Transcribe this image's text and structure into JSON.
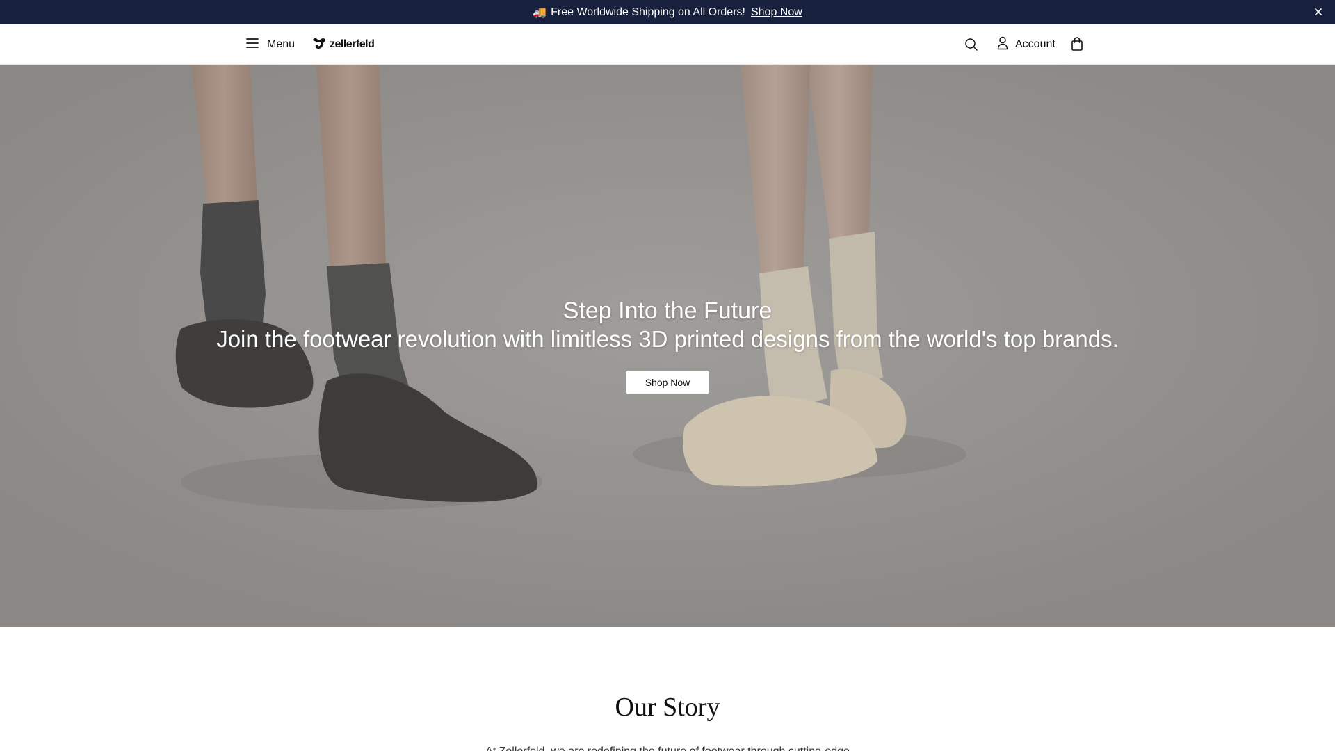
{
  "announcement": {
    "emoji": "🚚",
    "text": "Free Worldwide Shipping on All Orders!",
    "link_label": "Shop Now",
    "close_icon": "close-icon"
  },
  "header": {
    "menu_label": "Menu",
    "logo_text": "zellerfeld",
    "account_label": "Account",
    "icons": [
      "hamburger-icon",
      "logo-mark-icon",
      "search-icon",
      "user-icon",
      "shopping-bag-icon"
    ]
  },
  "hero": {
    "title": "Step Into the Future",
    "subtitle": "Join the footwear revolution with limitless 3D printed designs from the world's top brands.",
    "button_label": "Shop Now"
  },
  "story": {
    "title": "Our Story",
    "body": "At Zellerfeld, we are redefining the future of footwear through cutting-edge"
  },
  "colors": {
    "announcement_bg": "#17213d",
    "hero_bg": "#a29f9c",
    "text": "#111111"
  }
}
